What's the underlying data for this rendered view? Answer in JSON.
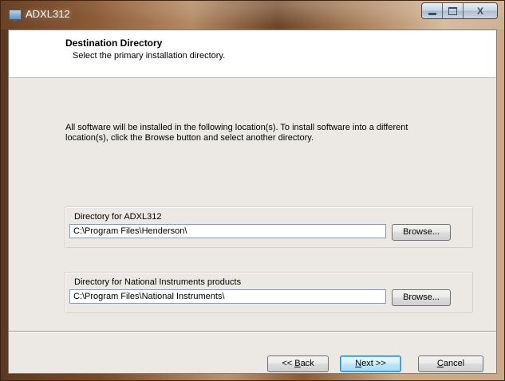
{
  "window": {
    "title": "ADXL312",
    "controls": {
      "minimize_icon": "minimize-icon",
      "maximize_icon": "maximize-icon",
      "close_icon": "close-icon",
      "close_glyph": "X"
    }
  },
  "header": {
    "title": "Destination Directory",
    "subtitle": "Select the primary installation directory."
  },
  "instructions": "All software will be installed in the following location(s). To install software into a different location(s), click the Browse button and select another directory.",
  "groups": [
    {
      "label": "Directory for ADXL312",
      "path": "C:\\Program Files\\Henderson\\",
      "browse_label": "Browse..."
    },
    {
      "label": "Directory for National Instruments products",
      "path": "C:\\Program Files\\National Instruments\\",
      "browse_label": "Browse..."
    }
  ],
  "footer": {
    "back": {
      "prefix": "<< ",
      "accel": "B",
      "rest": "ack"
    },
    "next": {
      "accel": "N",
      "rest": "ext >>"
    },
    "cancel": {
      "accel": "C",
      "rest": "ancel"
    }
  },
  "colors": {
    "client_bg": "#ece9e4",
    "header_bg": "#ffffff",
    "default_button_border": "#3c7fb1"
  }
}
